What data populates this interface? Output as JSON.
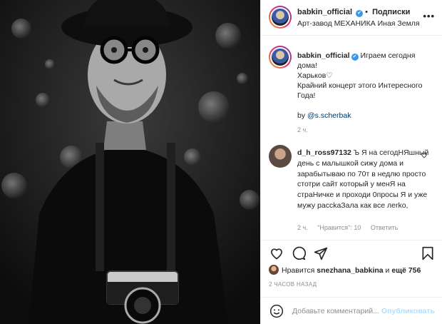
{
  "post": {
    "photo_icon": "portrait-photo"
  },
  "header": {
    "username": "babkin_official",
    "verified": "✔",
    "separator": "•",
    "follow_label": "Подписки",
    "location": "Арт-завод МЕХАНИКА Иная Земля",
    "more": "•••"
  },
  "caption": {
    "username": "babkin_official",
    "lines": [
      "Играем сегодня",
      "дома!",
      "Харьков♡",
      "Крайний концерт этого Интересного",
      "Года!"
    ],
    "by": "by ",
    "mention": "@s.scherbak",
    "time": "2 ч."
  },
  "comment": {
    "username": "d_h_ross97132",
    "text": "Ъ Я на сегодНЯшный день с малышкой сижу дома и зарабытываю по 70т в недлю просто стотри сайт который у менЯ на страНичке и проходи 0просы Я и уже мужу рассkаЗала как все лerko,",
    "time": "2 ч.",
    "likes_label": "\"Нравится\": 10",
    "reply_label": "Ответить"
  },
  "actions": {
    "like": "heart-icon",
    "comment": "comment-icon",
    "share": "share-icon",
    "save": "bookmark-icon"
  },
  "likes": {
    "prefix": "Нравится ",
    "user": "snezhana_babkina",
    "and": " и ",
    "more": "ещё 756"
  },
  "ago": "2 ЧАСОВ НАЗАД",
  "add_comment": {
    "placeholder": "Добавьте комментарий...",
    "publish": "Опубликовать"
  }
}
